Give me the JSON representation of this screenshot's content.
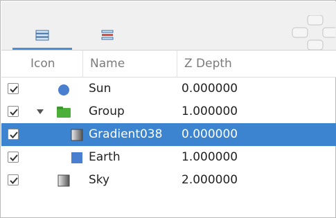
{
  "tabs": [
    {
      "icon": "layers-icon",
      "active": true
    },
    {
      "icon": "params-icon",
      "active": false
    }
  ],
  "columns": {
    "icon": "Icon",
    "name": "Name",
    "z": "Z Depth"
  },
  "layers": [
    {
      "name": "Sun",
      "z": "0.000000",
      "icon": "circle-layer-icon",
      "checked": true,
      "selected": false
    },
    {
      "name": "Group",
      "z": "1.000000",
      "icon": "folder-icon",
      "checked": true,
      "selected": false,
      "expanded": true
    },
    {
      "name": "Gradient038",
      "z": "0.000000",
      "icon": "gradient-layer-icon",
      "checked": true,
      "selected": true
    },
    {
      "name": "Earth",
      "z": "1.000000",
      "icon": "rectangle-layer-icon",
      "checked": true,
      "selected": false
    },
    {
      "name": "Sky",
      "z": "2.000000",
      "icon": "gradient-layer-icon",
      "checked": true,
      "selected": false
    }
  ],
  "colors": {
    "selection": "#3c84cf",
    "tab_accent": "#4a90d9",
    "circle": "#4a7fd0",
    "folder": "#4caf3a",
    "rect": "#4a7fd0"
  }
}
